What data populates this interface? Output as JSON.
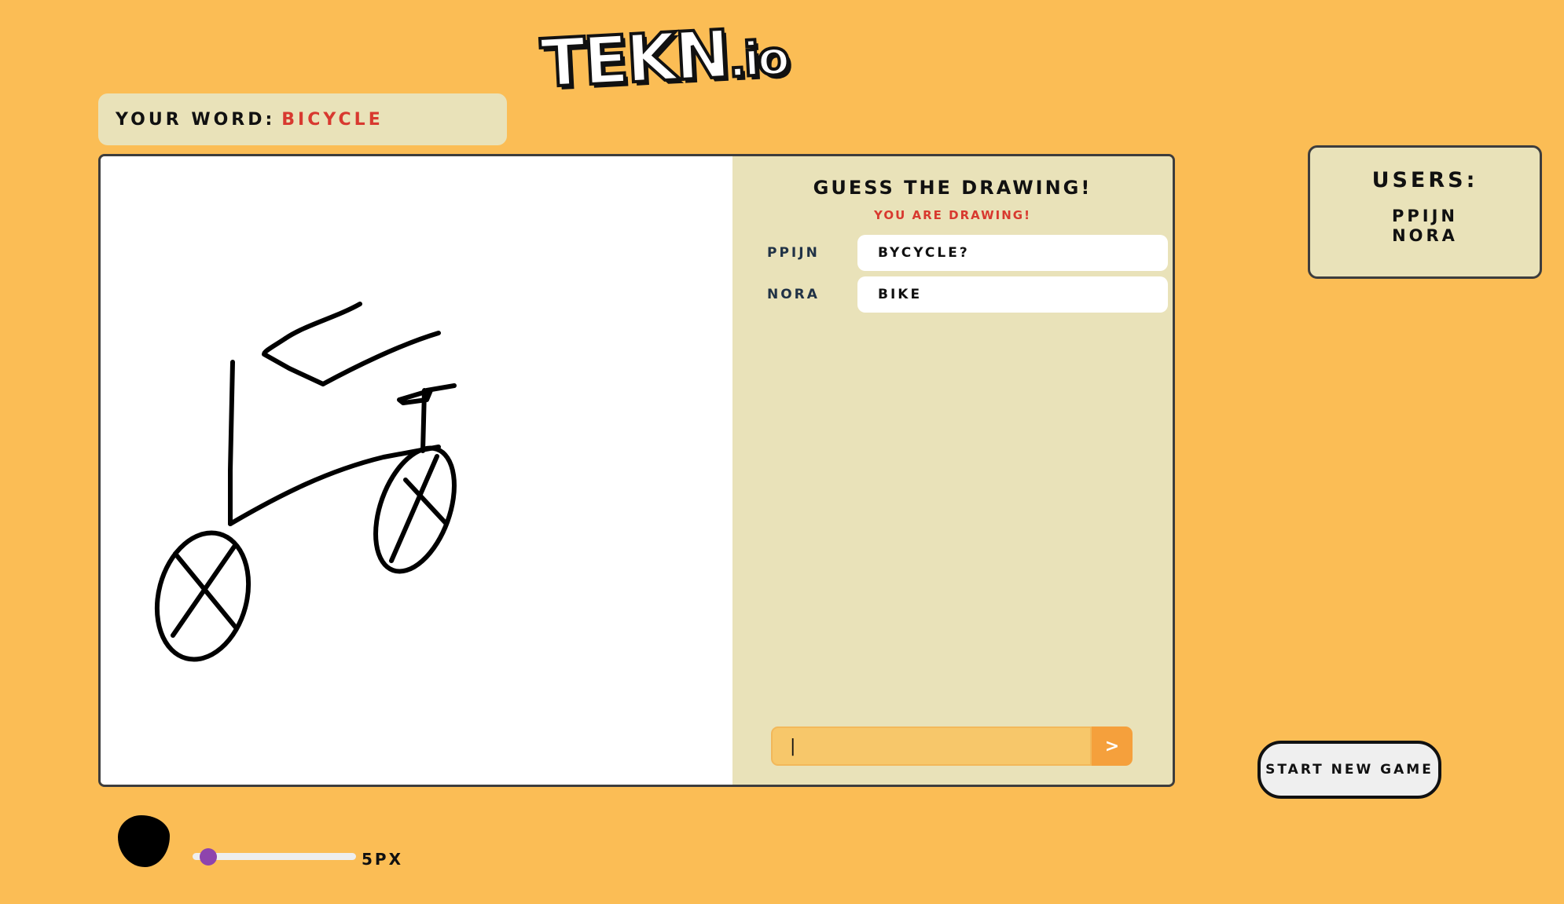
{
  "app": {
    "logo_text": "TEKN",
    "logo_suffix": ".io"
  },
  "word_prompt": {
    "label": "YOUR WORD:",
    "word": "BICYCLE"
  },
  "chat": {
    "title": "GUESS THE DRAWING!",
    "subtitle": "YOU ARE DRAWING!",
    "messages": [
      {
        "user": "PPIJN",
        "text": "BYCYCLE?"
      },
      {
        "user": "NORA",
        "text": "BIKE"
      }
    ],
    "input_value": "|",
    "send_label": ">"
  },
  "users": {
    "title": "USERS:",
    "list": [
      "PPIJN",
      "NORA"
    ]
  },
  "controls": {
    "new_game_label": "START NEW GAME",
    "brush_color": "#000000",
    "brush_size_label": "5PX",
    "brush_size_fraction": 0.05
  },
  "colors": {
    "background": "#fbbd55",
    "panel": "#e9e2b9",
    "accent_red": "#d8392f",
    "send_button": "#f5a03c",
    "slider_thumb": "#8e44ad"
  }
}
